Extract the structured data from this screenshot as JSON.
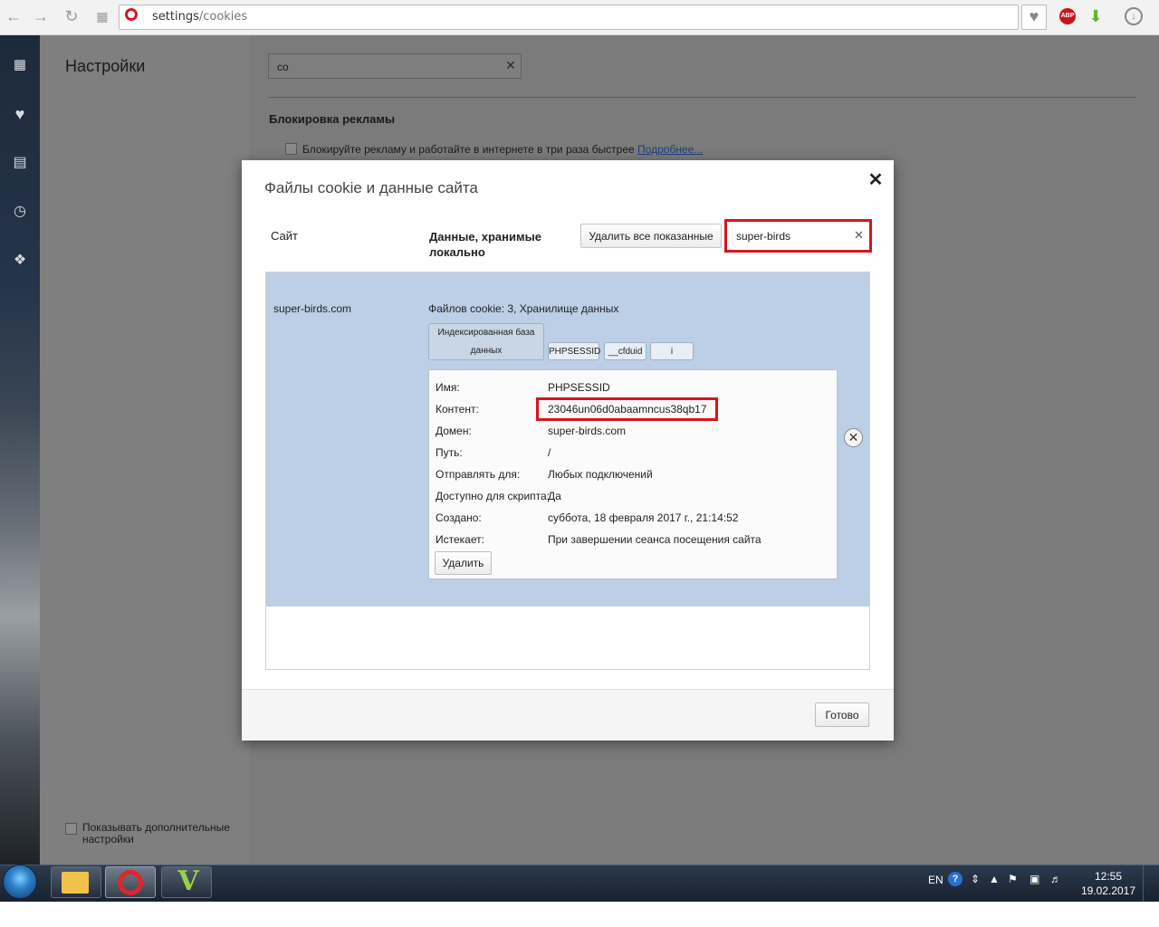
{
  "browser": {
    "url_host": "settings",
    "url_path": "/cookies",
    "icons": {
      "back": "back-arrow-icon",
      "forward": "forward-arrow-icon",
      "reload": "reload-icon",
      "speed_dial": "grid-icon",
      "opera": "opera-logo-icon",
      "favorite": "heart-icon",
      "adblock": "abp-icon",
      "downloader": "download-arrow-icon",
      "downloads": "downloads-icon"
    },
    "abp_label": "ABP"
  },
  "sidebar": {
    "items": [
      {
        "icon": "speed-dial-icon"
      },
      {
        "icon": "heart-icon"
      },
      {
        "icon": "news-icon"
      },
      {
        "icon": "history-clock-icon"
      },
      {
        "icon": "extensions-puzzle-icon"
      }
    ]
  },
  "settings": {
    "title": "Настройки",
    "search_value": "co",
    "ads_heading": "Блокировка рекламы",
    "ads_text": "Блокируйте рекламу и работайте в интернете в три раза быстрее ",
    "ads_link": "Подробнее...",
    "advanced_label": "Показывать дополнительные настройки"
  },
  "dialog": {
    "title": "Файлы cookie и данные сайта",
    "col_site": "Сайт",
    "col_data": "Данные, хранимые локально",
    "remove_all_label": "Удалить все показанные",
    "search_value": "super-birds",
    "site": {
      "name": "super-birds.com",
      "summary": "Файлов cookie: 3, Хранилище данных",
      "chips": [
        "Индексированная база данных",
        "PHPSESSID",
        "__cfduid",
        "i"
      ]
    },
    "cookie": {
      "name_label": "Имя:",
      "name_value": "PHPSESSID",
      "content_label": "Контент:",
      "content_value": "23046un06d0abaamncus38qb17",
      "domain_label": "Домен:",
      "domain_value": "super-birds.com",
      "path_label": "Путь:",
      "path_value": "/",
      "send_for_label": "Отправлять для:",
      "send_for_value": "Любых подключений",
      "script_label": "Доступно для скрипта:",
      "script_value": "Да",
      "created_label": "Создано:",
      "created_value": "суббота, 18 февраля 2017 г., 21:14:52",
      "expires_label": "Истекает:",
      "expires_value": "При завершении сеанса посещения сайта",
      "delete_label": "Удалить"
    },
    "done_label": "Готово",
    "colors": {
      "highlight": "#d8141c",
      "selected_row": "#bccfe6"
    }
  },
  "taskbar": {
    "apps": [
      "explorer-folder-icon",
      "opera-icon",
      "v-app-icon"
    ],
    "v_glyph": "V",
    "lang": "EN",
    "help_glyph": "?",
    "time": "12:55",
    "date": "19.02.2017"
  }
}
